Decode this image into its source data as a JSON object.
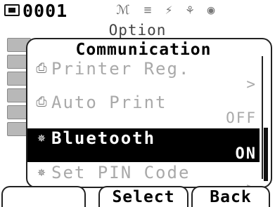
{
  "status_bar": {
    "sample_number": "0001",
    "icons": [
      "sample-icon",
      "measurement-mode-icon",
      "target-icon",
      "battery-icon",
      "flash-icon",
      "lamp-icon"
    ]
  },
  "header": {
    "title": "Option"
  },
  "panel": {
    "title": "Communication",
    "items": [
      {
        "icon": "printer-icon",
        "label": "Printer Reg.",
        "value": ">",
        "selected": false
      },
      {
        "icon": "auto-print-icon",
        "label": "Auto Print",
        "value": "OFF",
        "selected": false
      },
      {
        "icon": "bluetooth-icon",
        "label": "Bluetooth",
        "value": "ON",
        "selected": true
      },
      {
        "icon": "pin-code-icon",
        "label": "Set PIN Code",
        "value": ">",
        "selected": false
      }
    ],
    "scroll_position": 0.6
  },
  "softkeys": {
    "left": "",
    "middle": "Select",
    "right": "Back"
  },
  "colors": {
    "background": "#ffffff",
    "selected_bg": "#000000",
    "disabled_text": "#a9a9a9"
  }
}
